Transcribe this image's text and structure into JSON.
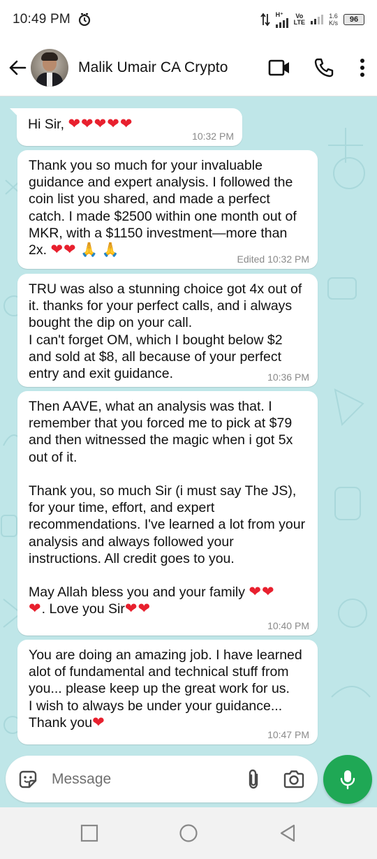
{
  "status_bar": {
    "time": "10:49 PM",
    "net_speed_value": "1.6",
    "net_speed_unit": "K/s",
    "battery": "96",
    "network_label_top": "H⁺",
    "network_label_vo": "Vo",
    "network_label_lte": "LTE"
  },
  "header": {
    "contact_name": "Malik Umair CA Crypto",
    "icons": [
      "back-arrow-icon",
      "video-call-icon",
      "phone-icon",
      "more-vert-icon"
    ]
  },
  "messages": [
    {
      "text_before": "Hi Sir, ",
      "hearts": "❤❤❤❤❤",
      "time": "10:32 PM"
    },
    {
      "text": "Thank you so much for your invaluable guidance and expert analysis. I followed the coin list you shared, and made a perfect catch. I made $2500 within one month out of MKR, with a $1150 investment—more than 2x. ",
      "hearts": "❤❤",
      "emoji_pray": " 🙏 🙏",
      "time": "Edited 10:32 PM"
    },
    {
      "text": "TRU was also a stunning choice got 4x out of it. thanks for your perfect calls, and i always bought the dip on your call.\nI can't forget OM, which I bought below $2 and sold at $8, all because of your perfect entry and exit guidance.",
      "time": "10:36 PM"
    },
    {
      "text": "Then AAVE, what an analysis was that. I remember that you forced me to pick at $79 and then witnessed the magic when i got 5x out of it.\n\nThank you, so much Sir (i must say The JS), for your time, effort, and expert recommendations. I've learned a lot from your analysis and always followed your instructions. All credit goes to you.\n\nMay Allah bless you and your family ",
      "hearts_a": "❤❤",
      "hearts_b": "❤",
      "text_after": ". Love you Sir",
      "hearts_c": "❤❤",
      "time": "10:40 PM"
    },
    {
      "text": "You are doing an amazing job. I have learned alot of fundamental and technical stuff from you... please keep up the great work for us.\nI wish to always be under your guidance...\nThank you",
      "hearts": "❤",
      "time": "10:47 PM"
    }
  ],
  "composer": {
    "placeholder": "Message",
    "icons": [
      "sticker-icon",
      "attach-icon",
      "camera-icon",
      "mic-icon"
    ]
  },
  "colors": {
    "chat_background": "#bfe6e8",
    "bubble": "#ffffff",
    "accent_green": "#1fa855",
    "heart_red": "#e8202e"
  }
}
